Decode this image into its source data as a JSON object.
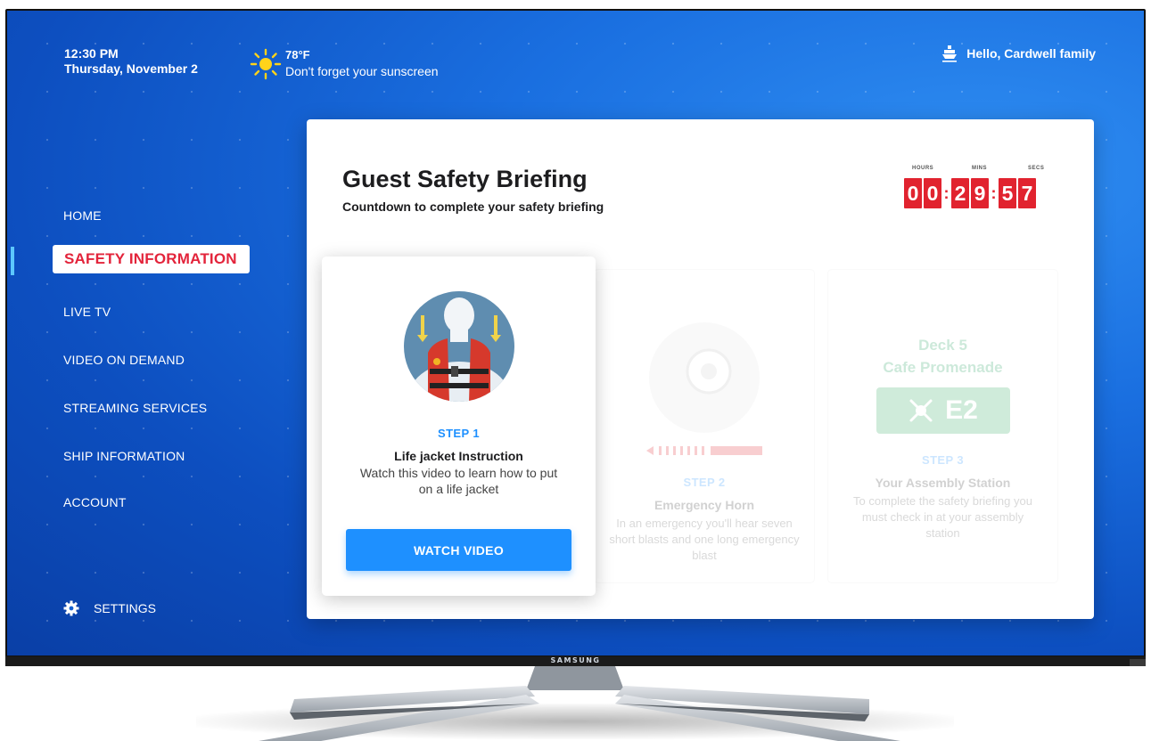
{
  "brand": "SAMSUNG",
  "header": {
    "time": "12:30 PM",
    "date": "Thursday, November 2",
    "temperature": "78°F",
    "weather_note": "Don't forget your sunscreen",
    "greeting": "Hello, Cardwell family"
  },
  "nav": {
    "items": [
      {
        "label": "HOME"
      },
      {
        "label": "SAFETY INFORMATION",
        "active": true
      },
      {
        "label": "LIVE TV"
      },
      {
        "label": "VIDEO ON DEMAND"
      },
      {
        "label": "STREAMING SERVICES"
      },
      {
        "label": "SHIP INFORMATION"
      },
      {
        "label": "ACCOUNT"
      }
    ],
    "settings_label": "SETTINGS"
  },
  "panel": {
    "title": "Guest Safety Briefing",
    "subtitle": "Countdown to complete your safety briefing",
    "countdown": {
      "labels": {
        "hours": "HOURS",
        "mins": "MINS",
        "secs": "SECS"
      },
      "digits": [
        "0",
        "0",
        "2",
        "9",
        "5",
        "7"
      ]
    },
    "steps": [
      {
        "step": "STEP 1",
        "title": "Life jacket Instruction",
        "body": "Watch this video to learn how to put on a life jacket",
        "button": "WATCH VIDEO"
      },
      {
        "step": "STEP 2",
        "title": "Emergency Horn",
        "body": "In an emergency you'll hear seven short blasts and one long emergency blast"
      },
      {
        "step": "STEP 3",
        "title": "Your Assembly Station",
        "body": "To complete the safety briefing you must check in at your assembly station",
        "deck": "Deck 5",
        "location": "Cafe Promenade",
        "station": "E2"
      }
    ]
  },
  "colors": {
    "accent_red": "#e1232f",
    "accent_blue": "#1e90ff",
    "station_green": "#2ba85a"
  }
}
